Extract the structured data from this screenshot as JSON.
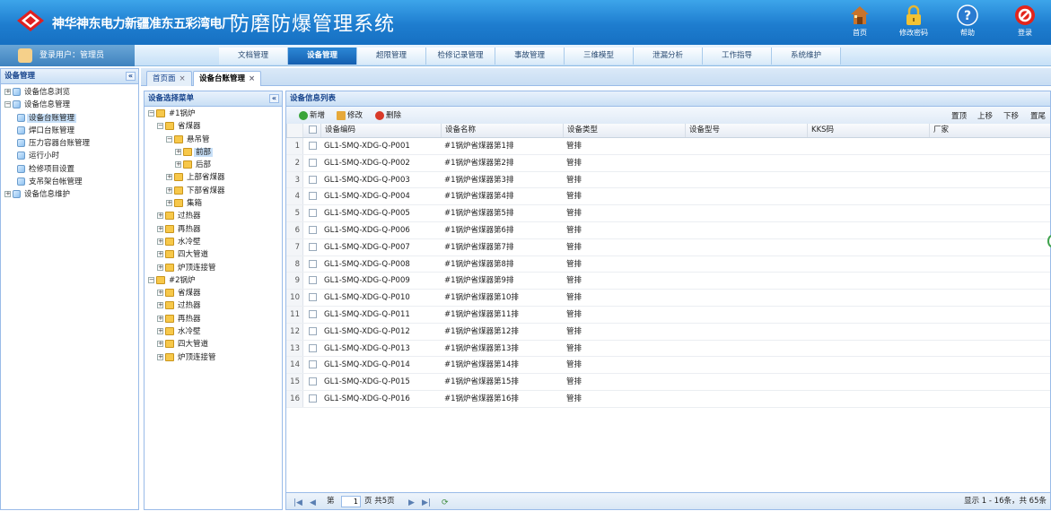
{
  "header": {
    "company": "神华神东电力新疆准东五彩湾电厂",
    "system_title": "防磨防爆管理系统",
    "buttons": [
      {
        "label": "首页",
        "icon": "home-icon"
      },
      {
        "label": "修改密码",
        "icon": "lock-icon"
      },
      {
        "label": "帮助",
        "icon": "help-icon"
      },
      {
        "label": "登录",
        "icon": "logout-icon"
      }
    ]
  },
  "user": {
    "label": "登录用户：管理员"
  },
  "nav": [
    {
      "label": "文档管理",
      "active": false
    },
    {
      "label": "设备管理",
      "active": true
    },
    {
      "label": "超限管理",
      "active": false
    },
    {
      "label": "检修记录管理",
      "active": false
    },
    {
      "label": "事故管理",
      "active": false
    },
    {
      "label": "三维模型",
      "active": false
    },
    {
      "label": "泄漏分析",
      "active": false
    },
    {
      "label": "工作指导",
      "active": false
    },
    {
      "label": "系统维护",
      "active": false
    }
  ],
  "left_panel": {
    "title": "设备管理",
    "collapse": "«",
    "items": [
      {
        "label": "设备信息浏览",
        "level": 0,
        "expander": "+"
      },
      {
        "label": "设备信息管理",
        "level": 0,
        "expander": "−"
      },
      {
        "label": "设备台账管理",
        "level": 1,
        "expander": "",
        "selected": true
      },
      {
        "label": "焊口台账管理",
        "level": 1,
        "expander": ""
      },
      {
        "label": "压力容器台账管理",
        "level": 1,
        "expander": ""
      },
      {
        "label": "运行小时",
        "level": 1,
        "expander": ""
      },
      {
        "label": "检修项目设置",
        "level": 1,
        "expander": ""
      },
      {
        "label": "支吊架台帐管理",
        "level": 1,
        "expander": ""
      },
      {
        "label": "设备信息维护",
        "level": 0,
        "expander": "+"
      }
    ]
  },
  "tabs": [
    {
      "label": "首页面",
      "close": "×",
      "active": false
    },
    {
      "label": "设备台账管理",
      "close": "×",
      "active": true
    }
  ],
  "mid_panel": {
    "title": "设备选择菜单",
    "collapse": "«",
    "tree": [
      {
        "label": "#1锅炉",
        "level": 0,
        "expander": "−"
      },
      {
        "label": "省煤器",
        "level": 1,
        "expander": "−"
      },
      {
        "label": "悬吊管",
        "level": 2,
        "expander": "−"
      },
      {
        "label": "前部",
        "level": 3,
        "expander": "+",
        "selected": true
      },
      {
        "label": "后部",
        "level": 3,
        "expander": "+"
      },
      {
        "label": "上部省煤器",
        "level": 2,
        "expander": "+"
      },
      {
        "label": "下部省煤器",
        "level": 2,
        "expander": "+"
      },
      {
        "label": "集箱",
        "level": 2,
        "expander": "+"
      },
      {
        "label": "过热器",
        "level": 1,
        "expander": "+"
      },
      {
        "label": "再热器",
        "level": 1,
        "expander": "+"
      },
      {
        "label": "水冷壁",
        "level": 1,
        "expander": "+"
      },
      {
        "label": "四大管道",
        "level": 1,
        "expander": "+"
      },
      {
        "label": "炉顶连接管",
        "level": 1,
        "expander": "+"
      },
      {
        "label": "#2锅炉",
        "level": 0,
        "expander": "−"
      },
      {
        "label": "省煤器",
        "level": 1,
        "expander": "+"
      },
      {
        "label": "过热器",
        "level": 1,
        "expander": "+"
      },
      {
        "label": "再热器",
        "level": 1,
        "expander": "+"
      },
      {
        "label": "水冷壁",
        "level": 1,
        "expander": "+"
      },
      {
        "label": "四大管道",
        "level": 1,
        "expander": "+"
      },
      {
        "label": "炉顶连接管",
        "level": 1,
        "expander": "+"
      }
    ]
  },
  "right_panel": {
    "title": "设备信息列表",
    "toolbar": {
      "add": "新增",
      "edit": "修改",
      "delete": "删除",
      "top": "置顶",
      "up": "上移",
      "down": "下移",
      "bottom": "置尾"
    },
    "columns": [
      "设备编码",
      "设备名称",
      "设备类型",
      "设备型号",
      "KKS码",
      "厂家"
    ],
    "rows": [
      {
        "n": "1",
        "code": "GL1-SMQ-XDG-Q-P001",
        "name": "#1锅炉省煤器第1排",
        "type": "管排",
        "model": "",
        "kks": "",
        "vendor": ""
      },
      {
        "n": "2",
        "code": "GL1-SMQ-XDG-Q-P002",
        "name": "#1锅炉省煤器第2排",
        "type": "管排",
        "model": "",
        "kks": "",
        "vendor": ""
      },
      {
        "n": "3",
        "code": "GL1-SMQ-XDG-Q-P003",
        "name": "#1锅炉省煤器第3排",
        "type": "管排",
        "model": "",
        "kks": "",
        "vendor": ""
      },
      {
        "n": "4",
        "code": "GL1-SMQ-XDG-Q-P004",
        "name": "#1锅炉省煤器第4排",
        "type": "管排",
        "model": "",
        "kks": "",
        "vendor": ""
      },
      {
        "n": "5",
        "code": "GL1-SMQ-XDG-Q-P005",
        "name": "#1锅炉省煤器第5排",
        "type": "管排",
        "model": "",
        "kks": "",
        "vendor": ""
      },
      {
        "n": "6",
        "code": "GL1-SMQ-XDG-Q-P006",
        "name": "#1锅炉省煤器第6排",
        "type": "管排",
        "model": "",
        "kks": "",
        "vendor": ""
      },
      {
        "n": "7",
        "code": "GL1-SMQ-XDG-Q-P007",
        "name": "#1锅炉省煤器第7排",
        "type": "管排",
        "model": "",
        "kks": "",
        "vendor": ""
      },
      {
        "n": "8",
        "code": "GL1-SMQ-XDG-Q-P008",
        "name": "#1锅炉省煤器第8排",
        "type": "管排",
        "model": "",
        "kks": "",
        "vendor": ""
      },
      {
        "n": "9",
        "code": "GL1-SMQ-XDG-Q-P009",
        "name": "#1锅炉省煤器第9排",
        "type": "管排",
        "model": "",
        "kks": "",
        "vendor": ""
      },
      {
        "n": "10",
        "code": "GL1-SMQ-XDG-Q-P010",
        "name": "#1锅炉省煤器第10排",
        "type": "管排",
        "model": "",
        "kks": "",
        "vendor": ""
      },
      {
        "n": "11",
        "code": "GL1-SMQ-XDG-Q-P011",
        "name": "#1锅炉省煤器第11排",
        "type": "管排",
        "model": "",
        "kks": "",
        "vendor": ""
      },
      {
        "n": "12",
        "code": "GL1-SMQ-XDG-Q-P012",
        "name": "#1锅炉省煤器第12排",
        "type": "管排",
        "model": "",
        "kks": "",
        "vendor": ""
      },
      {
        "n": "13",
        "code": "GL1-SMQ-XDG-Q-P013",
        "name": "#1锅炉省煤器第13排",
        "type": "管排",
        "model": "",
        "kks": "",
        "vendor": ""
      },
      {
        "n": "14",
        "code": "GL1-SMQ-XDG-Q-P014",
        "name": "#1锅炉省煤器第14排",
        "type": "管排",
        "model": "",
        "kks": "",
        "vendor": ""
      },
      {
        "n": "15",
        "code": "GL1-SMQ-XDG-Q-P015",
        "name": "#1锅炉省煤器第15排",
        "type": "管排",
        "model": "",
        "kks": "",
        "vendor": ""
      },
      {
        "n": "16",
        "code": "GL1-SMQ-XDG-Q-P016",
        "name": "#1锅炉省煤器第16排",
        "type": "管排",
        "model": "",
        "kks": "",
        "vendor": ""
      }
    ],
    "pager": {
      "page_prefix": "第",
      "page_value": "1",
      "page_suffix": "页 共5页",
      "summary": "显示 1 - 16条，共 65条"
    }
  }
}
